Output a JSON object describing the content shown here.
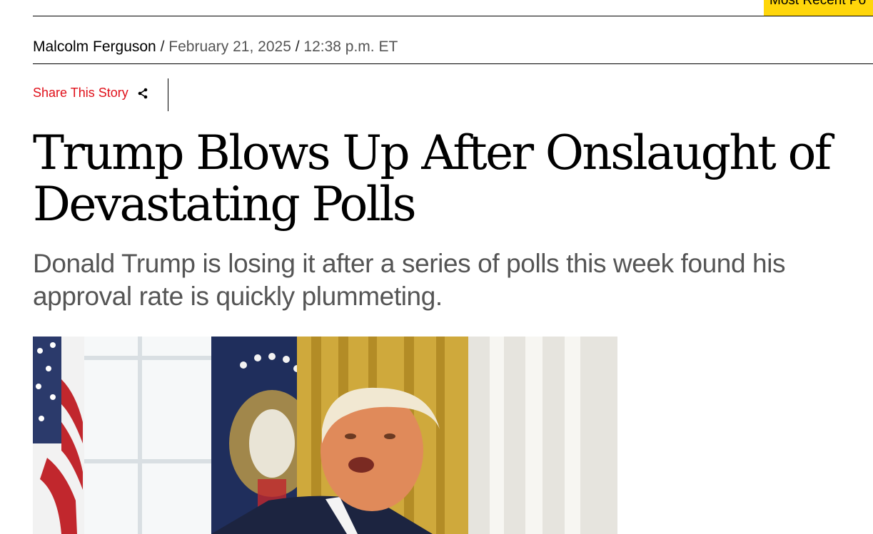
{
  "header": {
    "most_recent_label": "Most Recent Po"
  },
  "byline": {
    "author": "Malcolm Ferguson",
    "separator": "/",
    "date": "February 21, 2025",
    "time": "12:38 p.m. ET"
  },
  "share": {
    "label": "Share This Story",
    "icon": "share-icon"
  },
  "article": {
    "headline": "Trump Blows Up After Onslaught of Devastating Polls",
    "dek": "Donald Trump is losing it after a series of polls this week found his approval rate is quickly plummeting."
  },
  "colors": {
    "accent_red": "#e0101a",
    "tab_yellow": "#ffd60a",
    "dek_gray": "#555555"
  }
}
